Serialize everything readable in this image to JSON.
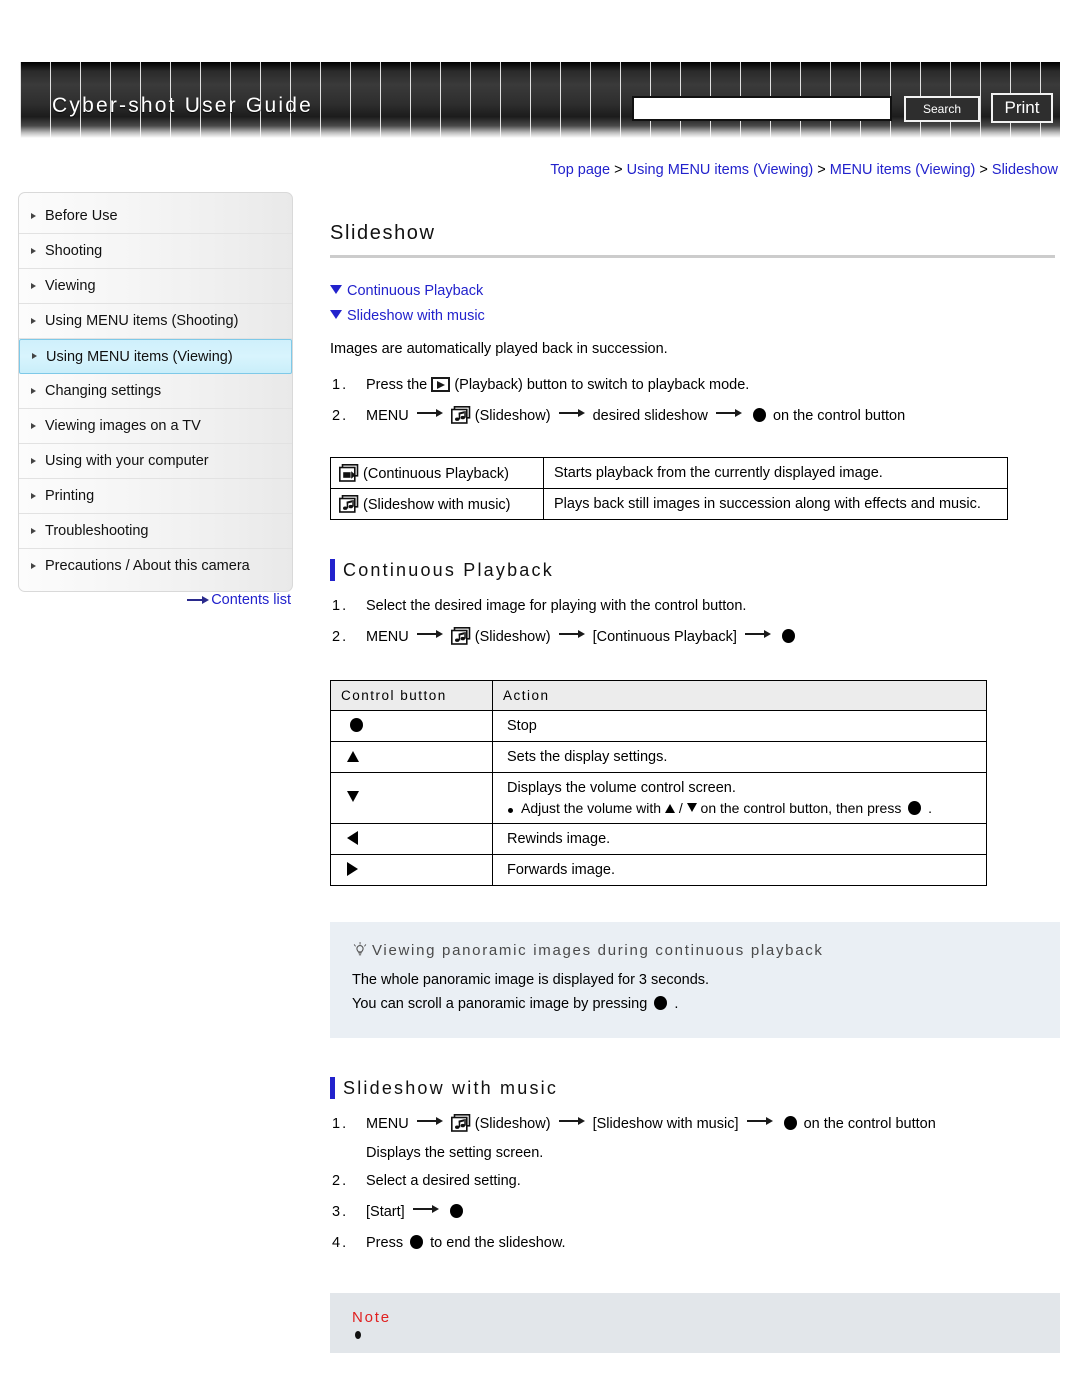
{
  "header": {
    "title": "Cyber-shot User Guide",
    "search_value": "",
    "search_placeholder": "",
    "search_button": "Search",
    "print_button": "Print"
  },
  "breadcrumb": {
    "items": [
      "Top page",
      "Using MENU items (Viewing)",
      "MENU items (Viewing)",
      "Slideshow"
    ],
    "separator": ">"
  },
  "sidebar": {
    "items": [
      {
        "label": "Before Use",
        "selected": false
      },
      {
        "label": "Shooting",
        "selected": false
      },
      {
        "label": "Viewing",
        "selected": false
      },
      {
        "label": "Using MENU items (Shooting)",
        "selected": false
      },
      {
        "label": "Using MENU items (Viewing)",
        "selected": true
      },
      {
        "label": "Changing settings",
        "selected": false
      },
      {
        "label": "Viewing images on a TV",
        "selected": false
      },
      {
        "label": "Using with your computer",
        "selected": false
      },
      {
        "label": "Printing",
        "selected": false
      },
      {
        "label": "Troubleshooting",
        "selected": false
      },
      {
        "label": "Precautions / About this camera",
        "selected": false
      }
    ],
    "contents_link": "Contents list"
  },
  "main": {
    "page_title": "Slideshow",
    "anchors": [
      {
        "label": "Continuous Playback"
      },
      {
        "label": "Slideshow with music"
      }
    ],
    "intro": "Images are automatically played back in succession.",
    "top_steps": {
      "step1": {
        "num": "1.",
        "a": "Press the",
        "icon": "playback-icon",
        "b": "(Playback) button to switch to playback mode."
      },
      "step2": {
        "num": "2.",
        "a": "MENU",
        "icon": "slideshow-icon",
        "b": "(Slideshow)",
        "c": "desired slideshow",
        "d": "on the control button"
      }
    },
    "modes_table": {
      "rows": [
        {
          "icon": "continuous-playback-icon",
          "mode": "(Continuous Playback)",
          "description": "Starts playback from the currently displayed image."
        },
        {
          "icon": "slideshow-with-music-icon",
          "mode": "(Slideshow with music)",
          "description": "Plays back still images in succession along with effects and music."
        }
      ]
    },
    "section_continuous": {
      "heading": "Continuous Playback",
      "step1": {
        "num": "1.",
        "text": "Select the desired image for playing with the control button."
      },
      "step2": {
        "num": "2.",
        "a": "MENU",
        "icon": "slideshow-icon",
        "b": "(Slideshow)",
        "c": "[Continuous Playback]"
      }
    },
    "control_table": {
      "headers": [
        "Control button",
        "Action"
      ],
      "rows": [
        {
          "button": "dot",
          "action": "Stop",
          "sub": ""
        },
        {
          "button": "up",
          "action": "Sets the display settings.",
          "sub": ""
        },
        {
          "button": "down",
          "action": "Displays the volume control screen.",
          "sub_a": "Adjust the volume with",
          "sub_sep": "/",
          "sub_b": "on the control button, then press",
          "sub_c": "."
        },
        {
          "button": "left",
          "action": "Rewinds image.",
          "sub": ""
        },
        {
          "button": "right",
          "action": "Forwards image.",
          "sub": ""
        }
      ]
    },
    "tip": {
      "icon": "lightbulb-icon",
      "title": "Viewing panoramic images during continuous playback",
      "line1": "The whole panoramic image is displayed for 3 seconds.",
      "line2_a": "You can scroll a panoramic image by pressing",
      "line2_b": "."
    },
    "section_music": {
      "heading": "Slideshow with music",
      "step1": {
        "num": "1.",
        "a": "MENU",
        "icon": "slideshow-icon",
        "b": "(Slideshow)",
        "c": "[Slideshow with music]",
        "d": "on the control button",
        "sub": "Displays the setting screen."
      },
      "step2": {
        "num": "2.",
        "text": "Select a desired setting."
      },
      "step3": {
        "num": "3.",
        "text": "[Start]"
      },
      "step4": {
        "num": "4.",
        "a": "Press",
        "b": "to end the slideshow."
      }
    },
    "note": {
      "title": "Note"
    }
  },
  "colors": {
    "link": "#2222cc",
    "accent_bar": "#2222cc",
    "selected_nav": "#cff0fb",
    "note_title": "#e02020",
    "tip_bg": "#eaeff4",
    "note_bg": "#e2e6ea"
  }
}
